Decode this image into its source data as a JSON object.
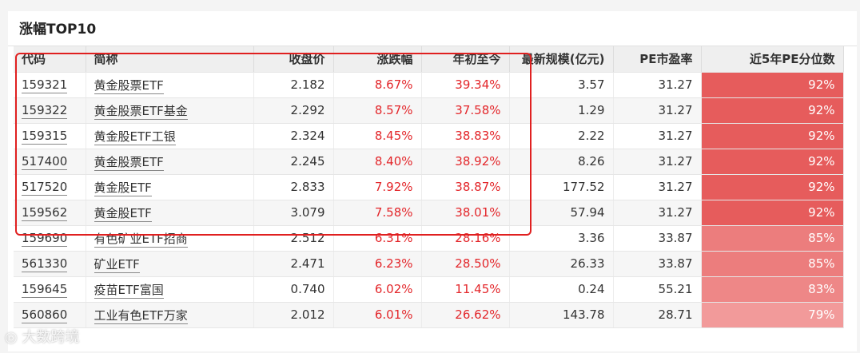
{
  "panel": {
    "title": "涨幅TOP10"
  },
  "table": {
    "headers": [
      "代码",
      "简称",
      "收盘价",
      "涨跌幅",
      "年初至今",
      "最新规模(亿元)",
      "PE市盈率",
      "近5年PE分位数"
    ],
    "rows": [
      {
        "code": "159321",
        "name": "黄金股票ETF",
        "close": "2.182",
        "change": "8.67%",
        "ytd": "39.34%",
        "scale": "3.57",
        "pe": "31.27",
        "pe_pct": "92%",
        "pe_pct_value": 92
      },
      {
        "code": "159322",
        "name": "黄金股票ETF基金",
        "close": "2.292",
        "change": "8.57%",
        "ytd": "37.58%",
        "scale": "1.29",
        "pe": "31.27",
        "pe_pct": "92%",
        "pe_pct_value": 92
      },
      {
        "code": "159315",
        "name": "黄金股ETF工银",
        "close": "2.324",
        "change": "8.45%",
        "ytd": "38.83%",
        "scale": "2.22",
        "pe": "31.27",
        "pe_pct": "92%",
        "pe_pct_value": 92
      },
      {
        "code": "517400",
        "name": "黄金股票ETF",
        "close": "2.245",
        "change": "8.40%",
        "ytd": "38.92%",
        "scale": "8.26",
        "pe": "31.27",
        "pe_pct": "92%",
        "pe_pct_value": 92
      },
      {
        "code": "517520",
        "name": "黄金股ETF",
        "close": "2.833",
        "change": "7.92%",
        "ytd": "38.87%",
        "scale": "177.52",
        "pe": "31.27",
        "pe_pct": "92%",
        "pe_pct_value": 92
      },
      {
        "code": "159562",
        "name": "黄金股ETF",
        "close": "3.079",
        "change": "7.58%",
        "ytd": "38.01%",
        "scale": "57.94",
        "pe": "31.27",
        "pe_pct": "92%",
        "pe_pct_value": 92
      },
      {
        "code": "159690",
        "name": "有色矿业ETF招商",
        "close": "2.512",
        "change": "6.31%",
        "ytd": "28.16%",
        "scale": "3.36",
        "pe": "33.87",
        "pe_pct": "85%",
        "pe_pct_value": 85
      },
      {
        "code": "561330",
        "name": "矿业ETF",
        "close": "2.471",
        "change": "6.23%",
        "ytd": "28.50%",
        "scale": "26.33",
        "pe": "33.87",
        "pe_pct": "85%",
        "pe_pct_value": 85
      },
      {
        "code": "159645",
        "name": "疫苗ETF富国",
        "close": "0.740",
        "change": "6.02%",
        "ytd": "11.45%",
        "scale": "0.24",
        "pe": "55.21",
        "pe_pct": "83%",
        "pe_pct_value": 83
      },
      {
        "code": "560860",
        "name": "工业有色ETF万家",
        "close": "2.012",
        "change": "6.01%",
        "ytd": "26.62%",
        "scale": "143.78",
        "pe": "28.71",
        "pe_pct": "79%",
        "pe_pct_value": 79
      }
    ]
  },
  "colors": {
    "up": "#e3262a",
    "heat_high": "#e65c5c",
    "heat_low": "#f29a9a",
    "highlight_border": "#e02020"
  },
  "watermark": {
    "text": "大数跨境",
    "icon": "weibo-like-logo-icon"
  }
}
